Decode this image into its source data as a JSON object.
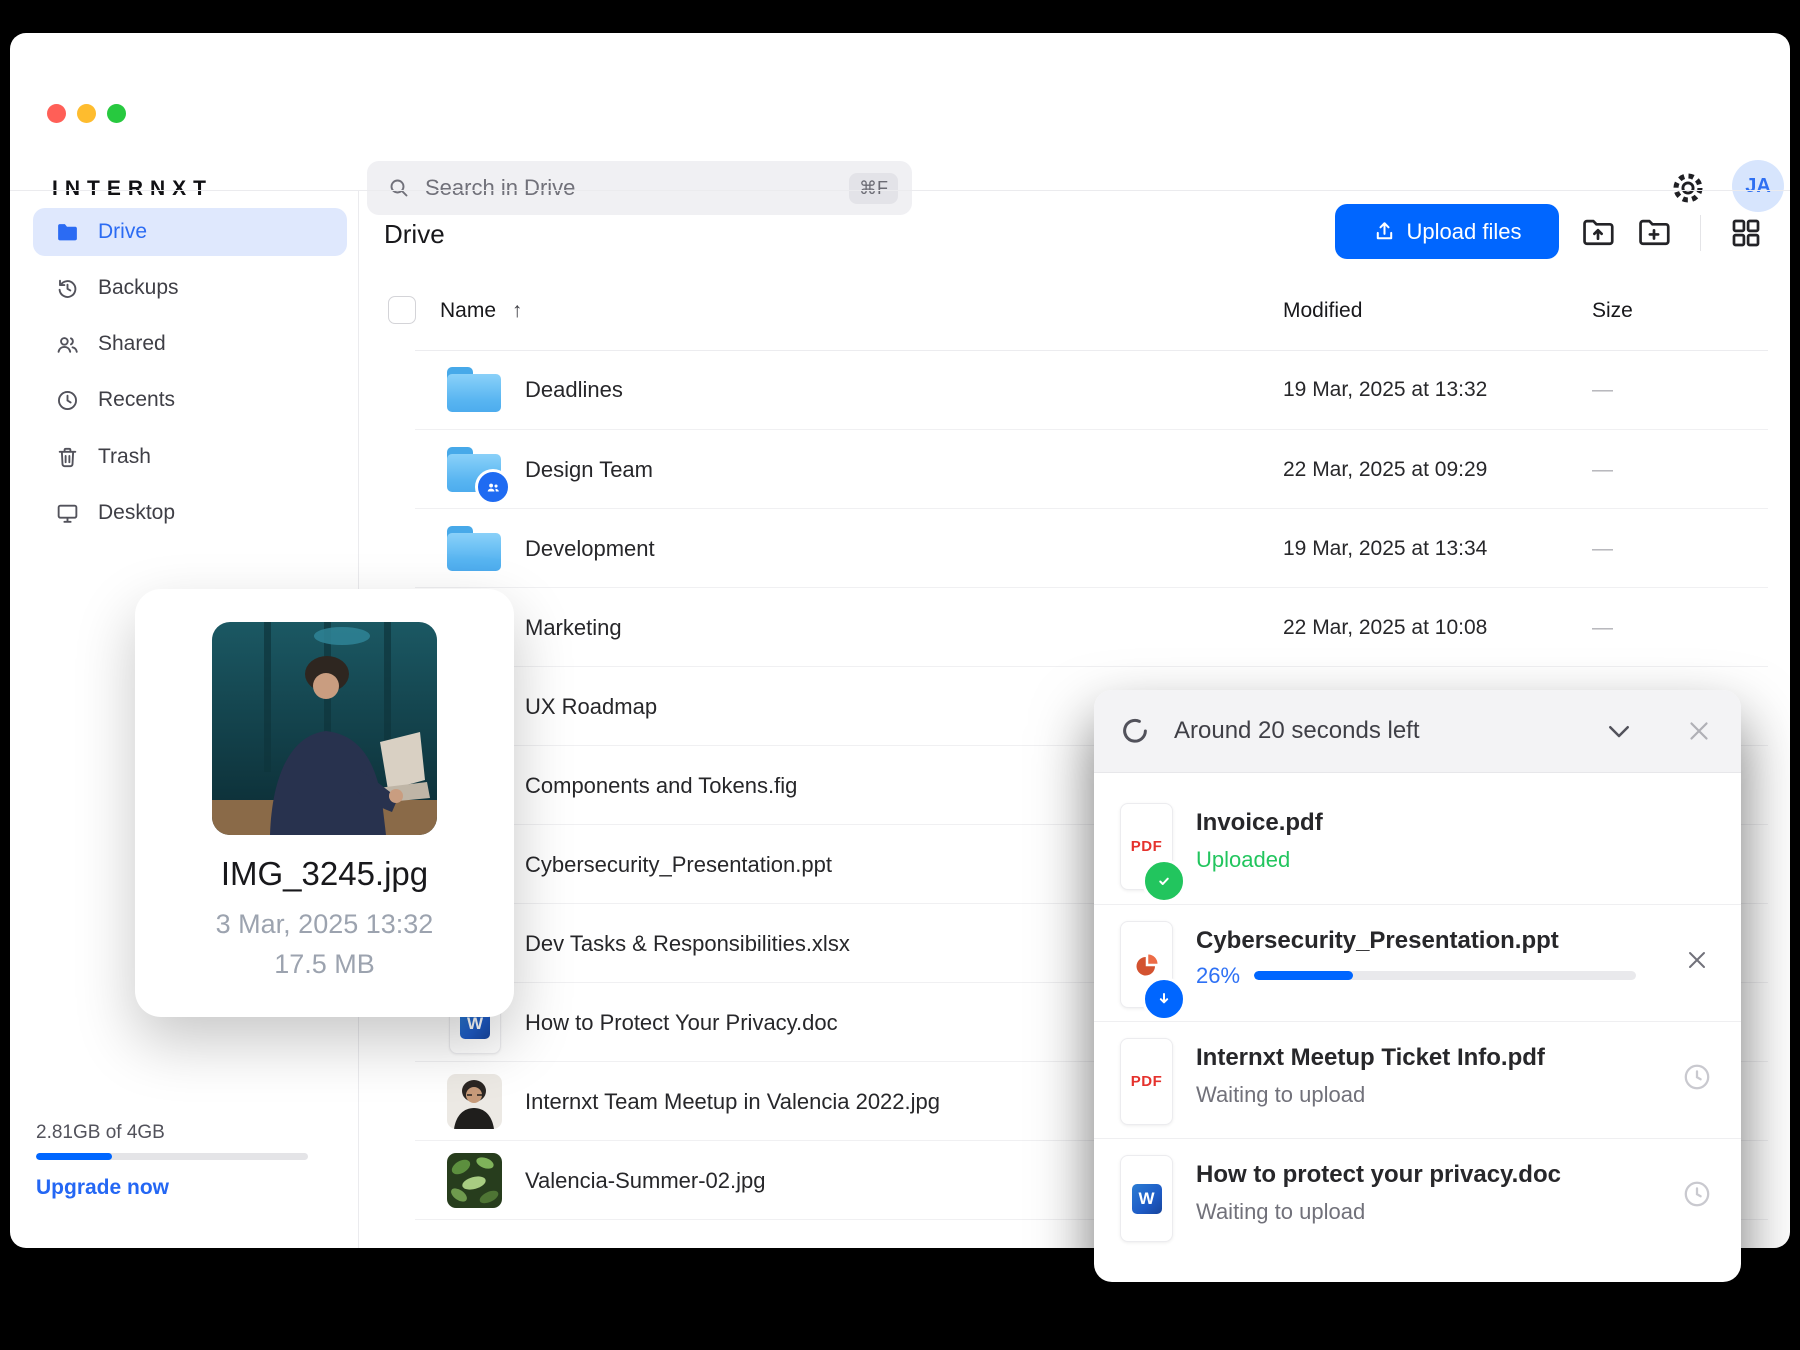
{
  "colors": {
    "accent": "#0066ff",
    "accent_text": "#2b6bf3",
    "success_green": "#22c55e",
    "folder_blue": "#58b5f1",
    "avatar_bg": "#d7e5fd",
    "traffic_red": "#ff5f57",
    "traffic_yellow": "#febc2e",
    "traffic_green": "#27c93f"
  },
  "window": {
    "brand": "INTERNXT"
  },
  "search": {
    "placeholder": "Search in Drive",
    "shortcut": "⌘F"
  },
  "user": {
    "initials": "JA"
  },
  "sidebar": {
    "items": [
      {
        "label": "Drive",
        "active": true
      },
      {
        "label": "Backups"
      },
      {
        "label": "Shared"
      },
      {
        "label": "Recents"
      },
      {
        "label": "Trash"
      },
      {
        "label": "Desktop"
      }
    ],
    "storage": {
      "usage": "2.81GB of 4GB",
      "percent_used": 28,
      "upgrade": "Upgrade now"
    }
  },
  "content": {
    "title": "Drive",
    "toolbar": {
      "upload_files": "Upload files"
    },
    "table": {
      "columns": {
        "name": "Name",
        "modified": "Modified",
        "size": "Size"
      },
      "sort_indicator": "↑",
      "rows": [
        {
          "name": "Deadlines",
          "type": "folder",
          "modified": "19 Mar, 2025 at 13:32",
          "size": "—"
        },
        {
          "name": "Design Team",
          "type": "folder-shared",
          "modified": "22 Mar, 2025 at 09:29",
          "size": "—"
        },
        {
          "name": "Development",
          "type": "folder",
          "modified": "19 Mar, 2025 at 13:34",
          "size": "—"
        },
        {
          "name": "Marketing",
          "modified": "22 Mar, 2025 at 10:08",
          "size": "—"
        },
        {
          "name": "UX Roadmap"
        },
        {
          "name": "Components and Tokens.fig"
        },
        {
          "name": "Cybersecurity_Presentation.ppt"
        },
        {
          "name": "Dev Tasks & Responsibilities.xlsx"
        },
        {
          "name": "How to Protect Your Privacy.doc",
          "type": "doc"
        },
        {
          "name": "Internxt Team Meetup in Valencia 2022.jpg",
          "type": "image"
        },
        {
          "name": "Valencia-Summer-02.jpg",
          "type": "image"
        }
      ]
    }
  },
  "preview_card": {
    "filename": "IMG_3245.jpg",
    "date": "3 Mar, 2025 13:32",
    "size": "17.5 MB"
  },
  "upload_panel": {
    "title": "Around 20 seconds left",
    "items": [
      {
        "name": "Invoice.pdf",
        "file_type": "pdf",
        "status": "Uploaded"
      },
      {
        "name": "Cybersecurity_Presentation.ppt",
        "file_type": "ppt",
        "status": "26%",
        "percent": 26
      },
      {
        "name": "Internxt Meetup Ticket Info.pdf",
        "file_type": "pdf",
        "status": "Waiting to upload"
      },
      {
        "name": "How to protect your privacy.doc",
        "file_type": "doc",
        "status": "Waiting to upload"
      }
    ]
  }
}
